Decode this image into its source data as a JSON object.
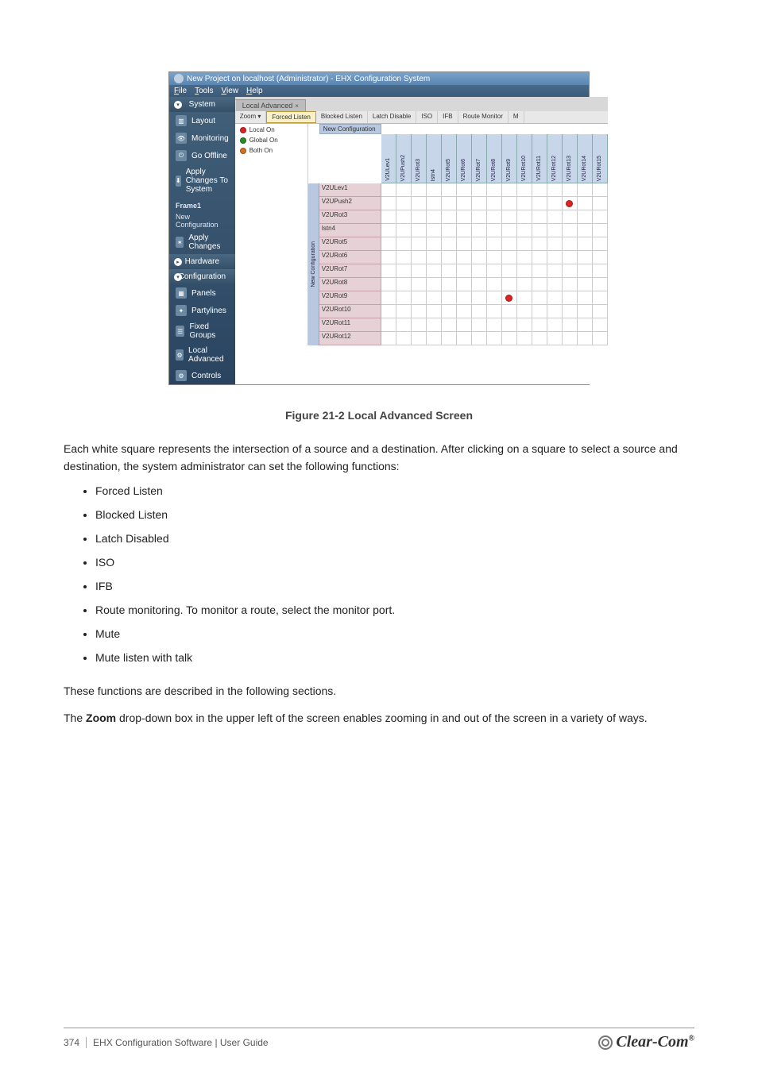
{
  "window_title": "New Project on localhost (Administrator) - EHX Configuration System",
  "menubar": [
    "File",
    "Tools",
    "View",
    "Help"
  ],
  "sidebar": {
    "system_head": "System",
    "items_top": [
      "Layout",
      "Monitoring",
      "Go Offline",
      "Apply Changes To System"
    ],
    "frame_label": "Frame1",
    "config_label": "New Configuration",
    "apply_changes": "Apply Changes",
    "hardware_head": "Hardware",
    "config_head": "Configuration",
    "items_bottom": [
      "Panels",
      "Partylines",
      "Fixed Groups",
      "Local Advanced",
      "Controls"
    ]
  },
  "tab": {
    "label": "Local Advanced",
    "close": "×"
  },
  "subtoolbar": [
    "Zoom ▾",
    "Forced Listen",
    "Blocked Listen",
    "Latch Disable",
    "ISO",
    "IFB",
    "Route Monitor",
    "M"
  ],
  "legend": {
    "local": "Local On",
    "global": "Global On",
    "both": "Both On"
  },
  "new_conf_label": "New Configuration",
  "columns": [
    "V2ULev1",
    "V2UPush2",
    "V2URot3",
    "Istn4",
    "V2URot5",
    "V2URot6",
    "V2URot7",
    "V2URot8",
    "V2URot9",
    "V2URot10",
    "V2URot11",
    "V2URot12",
    "V2URot13",
    "V2URot14",
    "V2URot15"
  ],
  "rows": [
    "V2ULev1",
    "V2UPush2",
    "V2URot3",
    "Istn4",
    "V2URot5",
    "V2URot6",
    "V2URot7",
    "V2URot8",
    "V2URot9",
    "V2URot10",
    "V2URot11",
    "V2URot12"
  ],
  "row_head_vert": "New Configuration",
  "marks": [
    {
      "row": 1,
      "col": 12,
      "color": "red"
    },
    {
      "row": 8,
      "col": 8,
      "color": "red"
    }
  ],
  "caption": "Figure 21-2 Local Advanced Screen",
  "para_1": "Each white square represents the intersection of a source and a destination. After clicking on a square to select a source and destination, the system administrator can set the following functions:",
  "options": [
    "Forced Listen",
    "Blocked Listen",
    "Latch Disabled",
    "ISO",
    "IFB",
    "Route monitoring. To monitor a route, select the monitor port.",
    "Mute",
    "Mute listen with talk"
  ],
  "para_2": "These functions are described in the following sections.",
  "para_3_prefix": "The ",
  "para_3_strong": "Zoom",
  "para_3_rest": " drop-down box in the upper left of the screen enables zooming in and out of the screen in a variety of ways.",
  "footer": {
    "page": "374",
    "doc": "EHX Configuration Software | User Guide"
  },
  "logo_text": "Clear-Com",
  "logo_reg": "®"
}
